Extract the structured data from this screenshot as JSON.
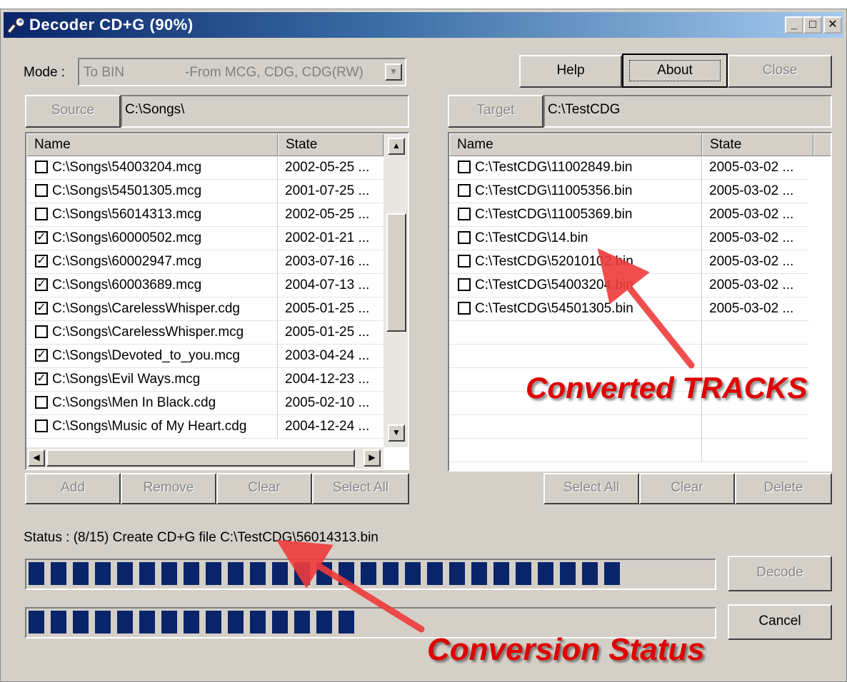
{
  "window": {
    "title": "Decoder CD+G (90%)"
  },
  "caption_buttons": {
    "minimize": "_",
    "maximize": "□",
    "close": "✕"
  },
  "mode": {
    "label": "Mode :",
    "value": "To BIN",
    "description": "-From MCG, CDG, CDG(RW)"
  },
  "top_buttons": {
    "help": "Help",
    "about": "About",
    "close": "Close"
  },
  "source": {
    "button": "Source",
    "path": "C:\\Songs\\"
  },
  "target": {
    "button": "Target",
    "path": "C:\\TestCDG"
  },
  "source_list": {
    "columns": [
      "Name",
      "State"
    ],
    "rows": [
      {
        "name": "C:\\Songs\\54003204.mcg",
        "state": "2002-05-25 ...",
        "checked": false
      },
      {
        "name": "C:\\Songs\\54501305.mcg",
        "state": "2001-07-25 ...",
        "checked": false
      },
      {
        "name": "C:\\Songs\\56014313.mcg",
        "state": "2002-05-25 ...",
        "checked": false
      },
      {
        "name": "C:\\Songs\\60000502.mcg",
        "state": "2002-01-21 ...",
        "checked": true
      },
      {
        "name": "C:\\Songs\\60002947.mcg",
        "state": "2003-07-16 ...",
        "checked": true
      },
      {
        "name": "C:\\Songs\\60003689.mcg",
        "state": "2004-07-13 ...",
        "checked": true
      },
      {
        "name": "C:\\Songs\\CarelessWhisper.cdg",
        "state": "2005-01-25 ...",
        "checked": true
      },
      {
        "name": "C:\\Songs\\CarelessWhisper.mcg",
        "state": "2005-01-25 ...",
        "checked": false
      },
      {
        "name": "C:\\Songs\\Devoted_to_you.mcg",
        "state": "2003-04-24 ...",
        "checked": true
      },
      {
        "name": "C:\\Songs\\Evil Ways.mcg",
        "state": "2004-12-23 ...",
        "checked": true
      },
      {
        "name": "C:\\Songs\\Men In Black.cdg",
        "state": "2005-02-10 ...",
        "checked": false
      },
      {
        "name": "C:\\Songs\\Music of My Heart.cdg",
        "state": "2004-12-24 ...",
        "checked": false
      }
    ]
  },
  "target_list": {
    "columns": [
      "Name",
      "State"
    ],
    "rows": [
      {
        "name": "C:\\TestCDG\\11002849.bin",
        "state": "2005-03-02 ...",
        "checked": false
      },
      {
        "name": "C:\\TestCDG\\11005356.bin",
        "state": "2005-03-02 ...",
        "checked": false
      },
      {
        "name": "C:\\TestCDG\\11005369.bin",
        "state": "2005-03-02 ...",
        "checked": false
      },
      {
        "name": "C:\\TestCDG\\14.bin",
        "state": "2005-03-02 ...",
        "checked": false
      },
      {
        "name": "C:\\TestCDG\\52010102.bin",
        "state": "2005-03-02 ...",
        "checked": false
      },
      {
        "name": "C:\\TestCDG\\54003204.bin",
        "state": "2005-03-02 ...",
        "checked": false
      },
      {
        "name": "C:\\TestCDG\\54501305.bin",
        "state": "2005-03-02 ...",
        "checked": false
      }
    ]
  },
  "source_buttons": {
    "add": "Add",
    "remove": "Remove",
    "clear": "Clear",
    "select_all": "Select All"
  },
  "target_buttons": {
    "select_all": "Select All",
    "clear": "Clear",
    "delete": "Delete"
  },
  "status": {
    "text": "Status : (8/15) Create CD+G file C:\\TestCDG\\56014313.bin"
  },
  "progress": {
    "file_blocks": 27,
    "overall_blocks": 15
  },
  "action_buttons": {
    "decode": "Decode",
    "cancel": "Cancel"
  },
  "annotations": {
    "tracks": "Converted TRACKS",
    "status": "Conversion Status"
  },
  "colors": {
    "accent": "#0a246a",
    "annotation": "#e00000",
    "face": "#d4d0c8"
  }
}
